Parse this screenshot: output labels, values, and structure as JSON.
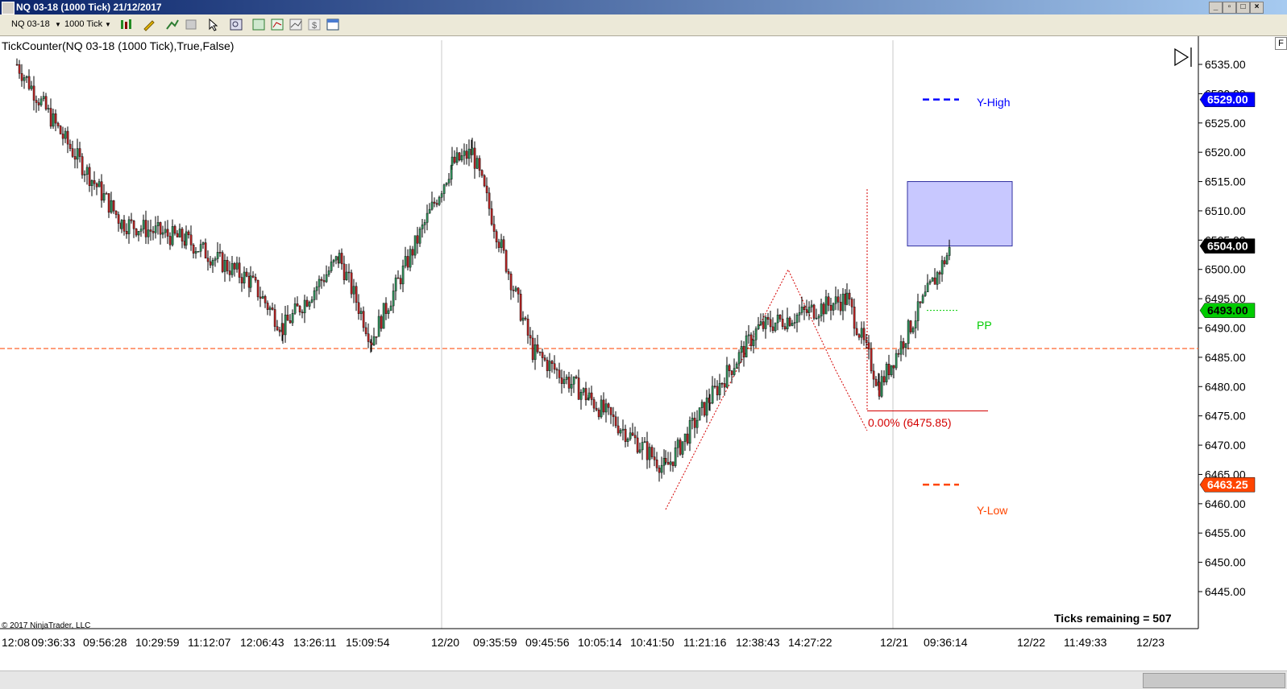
{
  "window": {
    "title": "NQ 03-18 (1000 Tick)  21/12/2017"
  },
  "toolbar": {
    "instrument": "NQ 03-18",
    "interval": "1000 Tick"
  },
  "chart": {
    "indicator_label": "TickCounter(NQ 03-18 (1000 Tick),True,False)",
    "copyright": "© 2017 NinjaTrader, LLC",
    "ticks_remaining": "Ticks remaining = 507",
    "price_axis": {
      "min": 6445,
      "max": 6535,
      "step": 5,
      "labels": [
        "6535.00",
        "6530.00",
        "6525.00",
        "6520.00",
        "6515.00",
        "6510.00",
        "6505.00",
        "6500.00",
        "6495.00",
        "6490.00",
        "6485.00",
        "6480.00",
        "6475.00",
        "6470.00",
        "6465.00",
        "6460.00",
        "6455.00",
        "6450.00",
        "6445.00"
      ]
    },
    "time_labels": [
      "12:08",
      "09:36:33",
      "09:56:28",
      "10:29:59",
      "11:12:07",
      "12:06:43",
      "13:26:11",
      "15:09:54",
      "12/20",
      "09:35:59",
      "09:45:56",
      "10:05:14",
      "10:41:50",
      "11:21:16",
      "12:38:43",
      "14:27:22",
      "12/21",
      "09:36:14",
      "12/22",
      "11:49:33",
      "12/23"
    ],
    "levels": {
      "y_high": {
        "label": "Y-High",
        "value": "6529.00",
        "price": 6529.0,
        "color": "#0000ff"
      },
      "current": {
        "value": "6504.00",
        "price": 6504.0,
        "color": "#000000"
      },
      "pp": {
        "label": "PP",
        "value": "6493.00",
        "price": 6493.0,
        "color": "#00cc00"
      },
      "y_low": {
        "label": "Y-Low",
        "value": "6463.25",
        "price": 6463.25,
        "color": "#ff4500"
      },
      "orange_line": {
        "price": 6486.5,
        "color": "#ff7f50"
      }
    },
    "fib_label": "0.00% (6475.85)",
    "zone": {
      "top": 6515,
      "bottom": 6504,
      "color": "#c8c8ff"
    }
  },
  "chart_data": {
    "type": "line",
    "title": "",
    "xlabel": "",
    "ylabel": "",
    "ylim": [
      6445,
      6535
    ],
    "x": [
      "12:08",
      "09:36:33",
      "09:56:28",
      "10:29:59",
      "11:12:07",
      "12:06:43",
      "13:26:11",
      "15:09:54",
      "12/20",
      "09:35:59",
      "09:45:56",
      "10:05:14",
      "10:41:50",
      "11:21:16",
      "12:38:43",
      "14:27:22",
      "12/21",
      "09:36:14"
    ],
    "values": [
      6535,
      6522,
      6508,
      6505,
      6498,
      6490,
      6502,
      6488,
      6518,
      6520,
      6486,
      6478,
      6466,
      6478,
      6490,
      6495,
      6480,
      6504
    ]
  }
}
